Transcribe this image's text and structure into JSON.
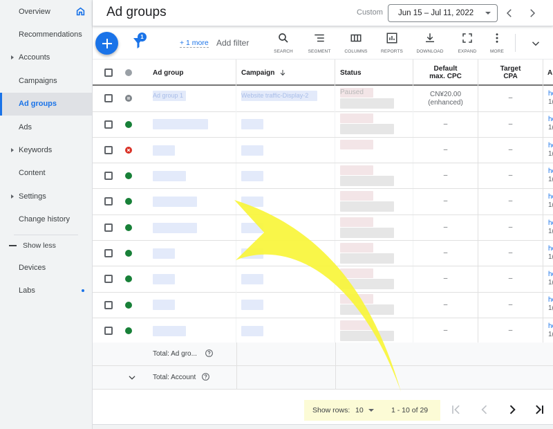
{
  "sidebar": {
    "items": [
      {
        "label": "Overview",
        "icon": "home-icon"
      },
      {
        "label": "Recommendations"
      },
      {
        "label": "Accounts",
        "expandable": true
      },
      {
        "label": "Campaigns"
      },
      {
        "label": "Ad groups",
        "active": true
      },
      {
        "label": "Ads"
      },
      {
        "label": "Keywords",
        "expandable": true
      },
      {
        "label": "Content"
      },
      {
        "label": "Settings",
        "expandable": true
      },
      {
        "label": "Change history"
      }
    ],
    "show_less_label": "Show less",
    "extra_items": [
      {
        "label": "Devices"
      },
      {
        "label": "Labs",
        "badge": "new-dot"
      }
    ]
  },
  "header": {
    "title": "Ad groups",
    "date_range_type": "Custom",
    "date_range": "Jun 15 – Jul 11, 2022"
  },
  "toolbar": {
    "filter_count": "1",
    "more_filters_link": "+ 1 more",
    "add_filter_label": "Add filter",
    "tools": [
      {
        "label": "SEARCH",
        "icon": "search-icon"
      },
      {
        "label": "SEGMENT",
        "icon": "segment-icon"
      },
      {
        "label": "COLUMNS",
        "icon": "columns-icon"
      },
      {
        "label": "REPORTS",
        "icon": "reports-icon"
      },
      {
        "label": "DOWNLOAD",
        "icon": "download-icon"
      },
      {
        "label": "EXPAND",
        "icon": "expand-icon"
      },
      {
        "label": "MORE",
        "icon": "more-vert-icon"
      }
    ]
  },
  "table": {
    "columns": {
      "ad_group": "Ad group",
      "campaign": "Campaign",
      "status": "Status",
      "default_cpc_line1": "Default",
      "default_cpc_line2": "max. CPC",
      "target_cpa_line1": "Target",
      "target_cpa_line2": "CPA",
      "next_col_fragment": "A"
    },
    "sort": {
      "column": "Campaign",
      "direction": "descending"
    },
    "rows": [
      {
        "status_icon": "paused",
        "ad_group": "Ad group 1",
        "campaign": "Website traffic-Display-2",
        "status": "Paused",
        "cpc_line1": "CN¥20.00",
        "cpc_line2": "(enhanced)",
        "target_cpa": "–",
        "frag_a": "he",
        "frag_b": "1("
      },
      {
        "status_icon": "eligible",
        "ad_group": "",
        "campaign": "",
        "status": "",
        "cpc_line1": "–",
        "cpc_line2": "",
        "target_cpa": "–",
        "frag_a": "he",
        "frag_b": "1("
      },
      {
        "status_icon": "removed",
        "ad_group": "",
        "campaign": "",
        "status": "",
        "cpc_line1": "–",
        "cpc_line2": "",
        "target_cpa": "–",
        "frag_a": "he",
        "frag_b": "1("
      },
      {
        "status_icon": "eligible",
        "ad_group": "",
        "campaign": "",
        "status": "",
        "cpc_line1": "–",
        "cpc_line2": "",
        "target_cpa": "–",
        "frag_a": "he",
        "frag_b": "1("
      },
      {
        "status_icon": "eligible",
        "ad_group": "",
        "campaign": "",
        "status": "",
        "cpc_line1": "–",
        "cpc_line2": "",
        "target_cpa": "–",
        "frag_a": "he",
        "frag_b": "1("
      },
      {
        "status_icon": "eligible",
        "ad_group": "",
        "campaign": "",
        "status": "",
        "cpc_line1": "–",
        "cpc_line2": "",
        "target_cpa": "–",
        "frag_a": "he",
        "frag_b": "1("
      },
      {
        "status_icon": "eligible",
        "ad_group": "",
        "campaign": "",
        "status": "",
        "cpc_line1": "–",
        "cpc_line2": "",
        "target_cpa": "–",
        "frag_a": "he",
        "frag_b": "1("
      },
      {
        "status_icon": "eligible",
        "ad_group": "",
        "campaign": "",
        "status": "",
        "cpc_line1": "–",
        "cpc_line2": "",
        "target_cpa": "–",
        "frag_a": "he",
        "frag_b": "1("
      },
      {
        "status_icon": "eligible",
        "ad_group": "",
        "campaign": "",
        "status": "",
        "cpc_line1": "–",
        "cpc_line2": "",
        "target_cpa": "–",
        "frag_a": "he",
        "frag_b": "1("
      },
      {
        "status_icon": "eligible",
        "ad_group": "",
        "campaign": "",
        "status": "",
        "cpc_line1": "–",
        "cpc_line2": "",
        "target_cpa": "–",
        "frag_a": "he",
        "frag_b": "1("
      }
    ],
    "totals": [
      {
        "label": "Total: Ad gro..."
      },
      {
        "label": "Total: Account"
      }
    ]
  },
  "pagination": {
    "show_rows_label": "Show rows:",
    "rows_per_page": "10",
    "range_text": "1 - 10 of 29"
  },
  "colors": {
    "accent": "#1a73e8",
    "eligible": "#188038",
    "removed": "#d93025",
    "paused": "#80868b",
    "annotation_arrow": "#f8f53a",
    "pager_highlight": "#fcfbd6"
  }
}
